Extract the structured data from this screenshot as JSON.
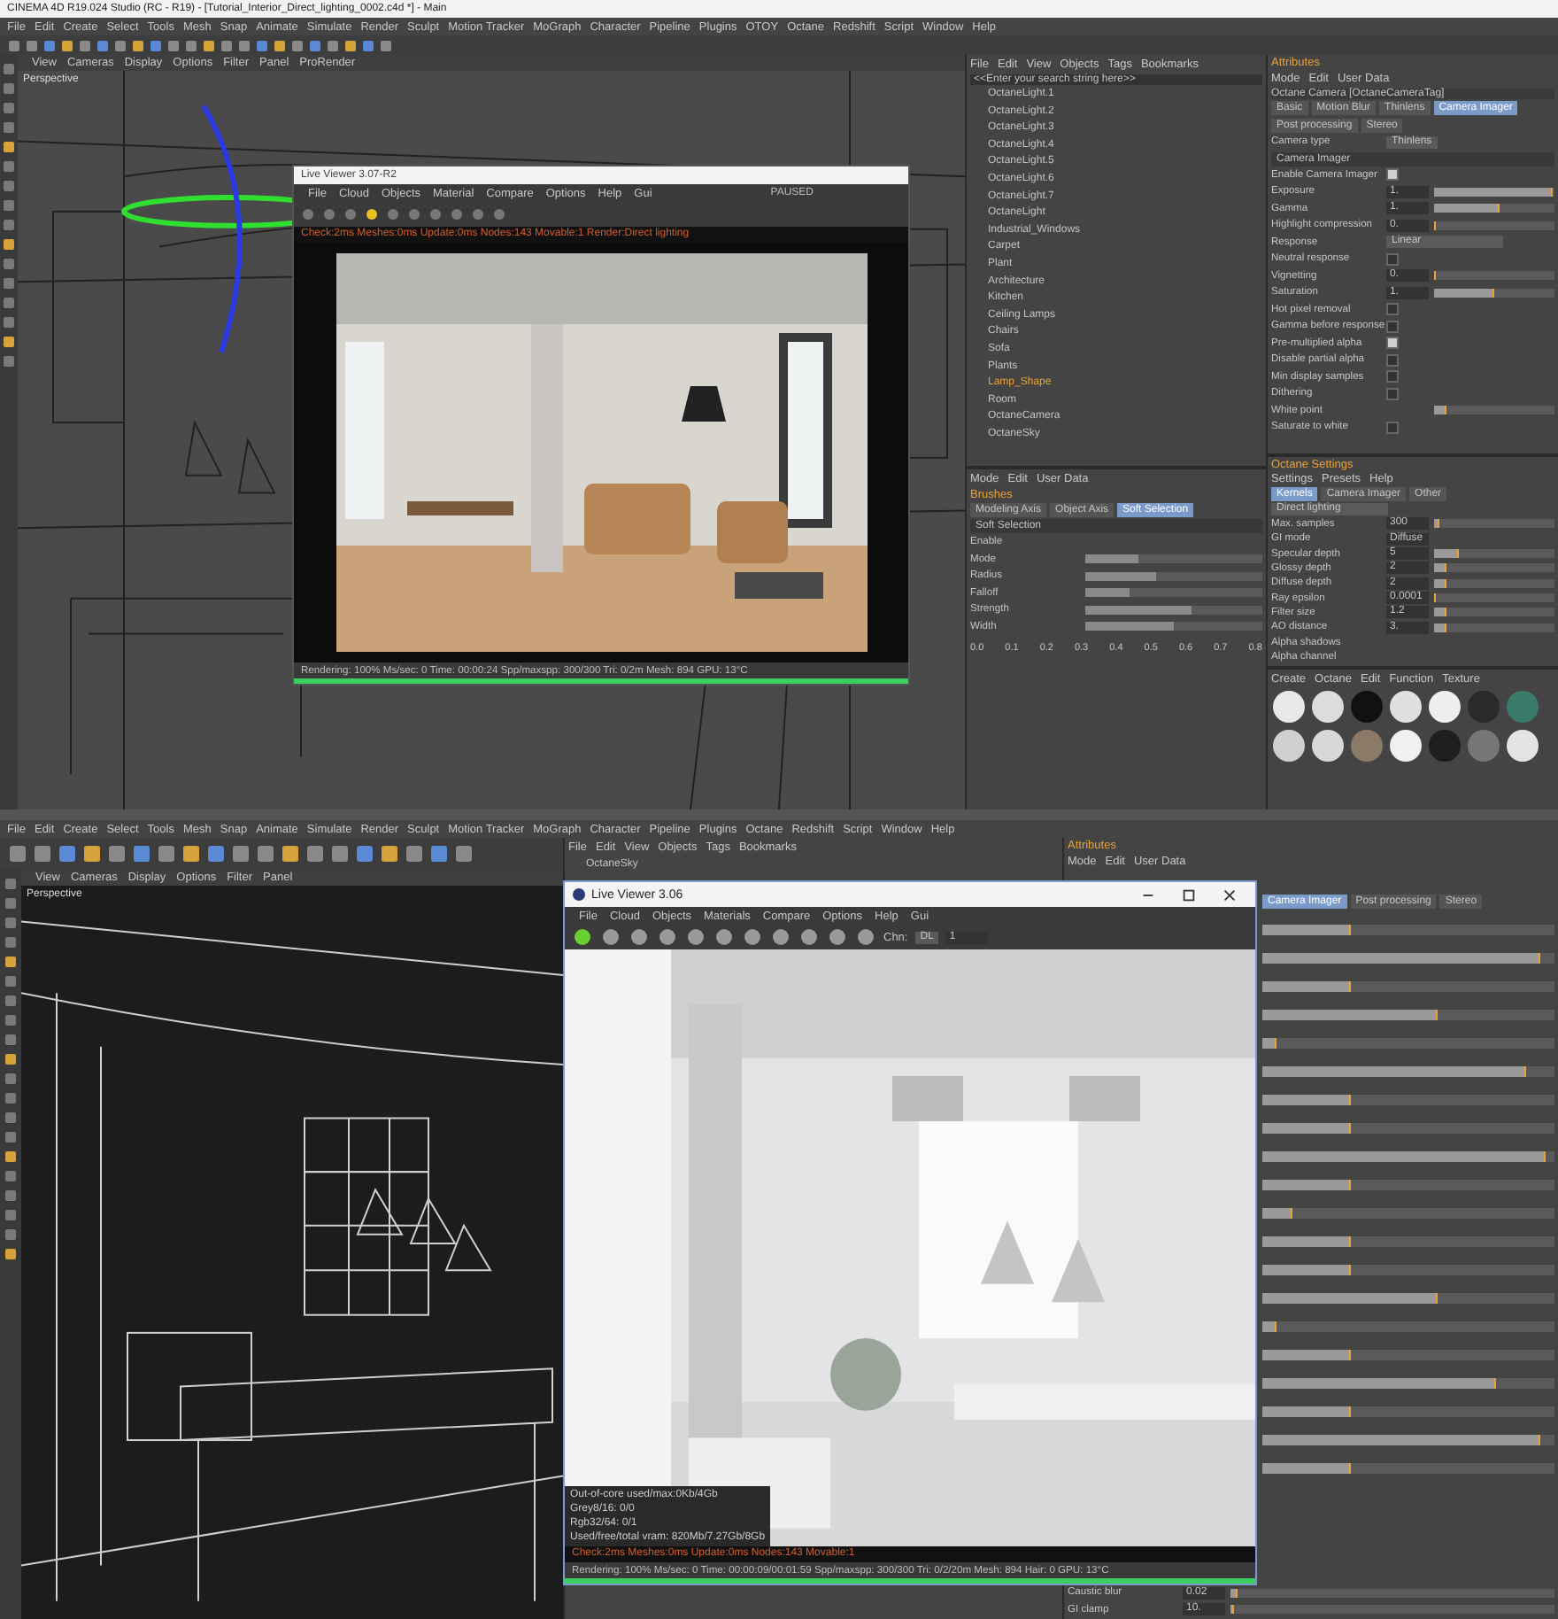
{
  "top": {
    "title": "CINEMA 4D R19.024 Studio (RC - R19) - [Tutorial_Interior_Direct_lighting_0002.c4d *] - Main",
    "menu": [
      "File",
      "Edit",
      "Create",
      "Select",
      "Tools",
      "Mesh",
      "Snap",
      "Animate",
      "Simulate",
      "Render",
      "Sculpt",
      "Motion Tracker",
      "MoGraph",
      "Character",
      "Pipeline",
      "Plugins",
      "OTOY",
      "Octane",
      "Redshift",
      "Script",
      "Window",
      "Help"
    ],
    "viewport": {
      "menu": [
        "View",
        "Cameras",
        "Display",
        "Options",
        "Filter",
        "Panel",
        "ProRender"
      ],
      "label": "Perspective"
    },
    "live_viewer": {
      "title": "Live Viewer 3.07-R2",
      "menu": [
        "File",
        "Cloud",
        "Objects",
        "Material",
        "Compare",
        "Options",
        "Help",
        "Gui"
      ],
      "state": "PAUSED",
      "status": "Check:2ms Meshes:0ms Update:0ms Nodes:143 Movable:1 Render:Direct lighting",
      "footer": "Rendering: 100%  Ms/sec: 0  Time: 00:00:24  Spp/maxspp: 300/300  Tri: 0/2m  Mesh: 894  GPU: 13°C",
      "level": 1
    },
    "objects": {
      "menu": [
        "File",
        "Edit",
        "View",
        "Objects",
        "Tags",
        "Bookmarks"
      ],
      "search": "<<Enter your search string here>>",
      "items": [
        {
          "name": "OctaneLight.1",
          "selected": false
        },
        {
          "name": "OctaneLight.2",
          "selected": false
        },
        {
          "name": "OctaneLight.3",
          "selected": false
        },
        {
          "name": "OctaneLight.4",
          "selected": false
        },
        {
          "name": "OctaneLight.5",
          "selected": false
        },
        {
          "name": "OctaneLight.6",
          "selected": false
        },
        {
          "name": "OctaneLight.7",
          "selected": false
        },
        {
          "name": "OctaneLight",
          "selected": false
        },
        {
          "name": "Industrial_Windows",
          "selected": false
        },
        {
          "name": "Carpet",
          "selected": false
        },
        {
          "name": "Plant",
          "selected": false
        },
        {
          "name": "Architecture",
          "selected": false
        },
        {
          "name": "Kitchen",
          "selected": false
        },
        {
          "name": "Ceiling Lamps",
          "selected": false
        },
        {
          "name": "Chairs",
          "selected": false
        },
        {
          "name": "Sofa",
          "selected": false
        },
        {
          "name": "Plants",
          "selected": false
        },
        {
          "name": "Lamp_Shape",
          "selected": true
        },
        {
          "name": "Room",
          "selected": false
        },
        {
          "name": "OctaneCamera",
          "selected": false
        },
        {
          "name": "OctaneSky",
          "selected": false
        }
      ]
    },
    "attributes": {
      "title": "Attributes",
      "menu": [
        "Mode",
        "Edit",
        "User Data"
      ],
      "object": "Octane Camera [OctaneCameraTag]",
      "tabs": [
        {
          "label": "Basic",
          "selected": false
        },
        {
          "label": "Motion Blur",
          "selected": false
        },
        {
          "label": "Thinlens",
          "selected": false
        },
        {
          "label": "Camera Imager",
          "selected": true
        },
        {
          "label": "Post processing",
          "selected": false
        },
        {
          "label": "Stereo",
          "selected": false
        }
      ],
      "camera_type_label": "Camera type",
      "camera_type": "Thinlens",
      "section": "Camera Imager",
      "params": [
        {
          "kind": "check",
          "label": "Enable Camera Imager",
          "checked": true
        },
        {
          "kind": "slider",
          "label": "Exposure",
          "value": "1.",
          "level": 0.98
        },
        {
          "kind": "slider",
          "label": "Gamma",
          "value": "1.",
          "level": 0.55
        },
        {
          "kind": "slider",
          "label": "Highlight compression",
          "value": "0.",
          "level": 0.02
        },
        {
          "kind": "select",
          "label": "Response",
          "value": "Linear"
        },
        {
          "kind": "check",
          "label": "Neutral response",
          "checked": false
        },
        {
          "kind": "slider",
          "label": "Vignetting",
          "value": "0.",
          "level": 0.02
        },
        {
          "kind": "slider",
          "label": "Saturation",
          "value": "1.",
          "level": 0.5
        },
        {
          "kind": "check",
          "label": "Hot pixel removal",
          "checked": false
        },
        {
          "kind": "check",
          "label": "Gamma before response",
          "checked": false
        },
        {
          "kind": "check",
          "label": "Pre-multiplied alpha",
          "checked": true
        },
        {
          "kind": "check",
          "label": "Disable partial alpha",
          "checked": false
        },
        {
          "kind": "check",
          "label": "Min display samples",
          "checked": false
        },
        {
          "kind": "check",
          "label": "Dithering",
          "checked": false
        },
        {
          "kind": "slider",
          "label": "White point",
          "level": 0.1
        },
        {
          "kind": "check",
          "label": "Saturate to white",
          "checked": false
        }
      ]
    },
    "modeling": {
      "menu": [
        "Mode",
        "Edit",
        "User Data"
      ],
      "title": "Brushes",
      "tabs": [
        {
          "label": "Modeling Axis",
          "selected": false
        },
        {
          "label": "Object Axis",
          "selected": false
        },
        {
          "label": "Soft Selection",
          "selected": true
        }
      ],
      "section": "Soft Selection",
      "rows": [
        {
          "label": "Enable"
        },
        {
          "label": "Mode",
          "level": 0.3
        },
        {
          "label": "Radius",
          "level": 0.4
        },
        {
          "label": "Falloff",
          "level": 0.25
        },
        {
          "label": "Strength",
          "level": 0.6
        },
        {
          "label": "Width",
          "level": 0.5
        }
      ],
      "axis": [
        "0.0",
        "0.1",
        "0.2",
        "0.3",
        "0.4",
        "0.5",
        "0.6",
        "0.7",
        "0.8"
      ]
    },
    "octane": {
      "title": "Octane Settings",
      "menu": [
        "Settings",
        "Presets",
        "Help"
      ],
      "tabs": [
        {
          "label": "Kernels",
          "selected": true
        },
        {
          "label": "Camera Imager",
          "selected": false
        },
        {
          "label": "Other",
          "selected": false
        }
      ],
      "kernel": "Direct lighting",
      "rows": [
        {
          "label": "Max. samples",
          "value": "300",
          "level": 0.05
        },
        {
          "label": "GI mode",
          "value": "Diffuse"
        },
        {
          "label": "Specular depth",
          "value": "5",
          "level": 0.2
        },
        {
          "label": "Glossy depth",
          "value": "2",
          "level": 0.1
        },
        {
          "label": "Diffuse depth",
          "value": "2",
          "level": 0.1
        },
        {
          "label": "Ray epsilon",
          "value": "0.0001",
          "level": 0.02
        },
        {
          "label": "Filter size",
          "value": "1.2",
          "level": 0.1
        },
        {
          "label": "AO distance",
          "value": "3.",
          "level": 0.1
        },
        {
          "label": "Alpha shadows"
        },
        {
          "label": "Alpha channel"
        }
      ]
    },
    "materials": {
      "menu": [
        "Create",
        "Octane",
        "Edit",
        "Function",
        "Texture"
      ],
      "balls": [
        {
          "color": "#e8e8e8"
        },
        {
          "color": "#dcdcdc"
        },
        {
          "color": "#111111"
        },
        {
          "color": "#e0e0e0"
        },
        {
          "color": "#eeeeee"
        },
        {
          "color": "#2a2a2a"
        },
        {
          "color": "#3a7a6a"
        },
        {
          "color": "#cfcfcf"
        },
        {
          "color": "#d8d8d8"
        },
        {
          "color": "#8c7a68"
        },
        {
          "color": "#f0f0f0"
        },
        {
          "color": "#1e1e1e"
        },
        {
          "color": "#767676"
        },
        {
          "color": "#e4e4e4"
        }
      ]
    }
  },
  "bottom": {
    "menu": [
      "File",
      "Edit",
      "Create",
      "Select",
      "Tools",
      "Mesh",
      "Snap",
      "Animate",
      "Simulate",
      "Render",
      "Sculpt",
      "Motion Tracker",
      "MoGraph",
      "Character",
      "Pipeline",
      "Plugins",
      "Octane",
      "Redshift",
      "Script",
      "Window",
      "Help"
    ],
    "viewport": {
      "menu": [
        "View",
        "Cameras",
        "Display",
        "Options",
        "Filter",
        "Panel"
      ],
      "label": "Perspective"
    },
    "objects": {
      "menu": [
        "File",
        "Edit",
        "View",
        "Objects",
        "Tags",
        "Bookmarks"
      ],
      "item": "OctaneSky"
    },
    "attributes": {
      "title": "Attributes",
      "menu": [
        "Mode",
        "Edit",
        "User Data"
      ],
      "tabs": [
        {
          "label": "Camera Imager",
          "selected": true
        },
        {
          "label": "Post processing",
          "selected": false
        },
        {
          "label": "Stereo",
          "selected": false
        }
      ],
      "sliders": [
        {
          "level": 0.3
        },
        {
          "level": 0.95
        },
        {
          "level": 0.3
        },
        {
          "level": 0.6
        },
        {
          "level": 0.05
        },
        {
          "level": 0.9
        },
        {
          "level": 0.3
        },
        {
          "level": 0.3
        },
        {
          "level": 0.97
        },
        {
          "level": 0.3
        },
        {
          "level": 0.1
        },
        {
          "level": 0.3
        },
        {
          "level": 0.3
        },
        {
          "level": 0.6
        },
        {
          "level": 0.05
        },
        {
          "level": 0.3
        },
        {
          "level": 0.8
        },
        {
          "level": 0.3
        },
        {
          "level": 0.95
        },
        {
          "level": 0.3
        }
      ],
      "params": [
        {
          "label": "Caustic blur",
          "value": "0.02",
          "level": 0.02
        },
        {
          "label": "GI clamp",
          "value": "10.",
          "level": 0.01
        }
      ]
    },
    "live_viewer": {
      "title": "Live Viewer 3.06",
      "menu": [
        "File",
        "Cloud",
        "Objects",
        "Materials",
        "Compare",
        "Options",
        "Help",
        "Gui"
      ],
      "channel_label": "Chn:",
      "channel": "DL",
      "layer": "1",
      "status": "Check:2ms Meshes:0ms Update:0ms Nodes:143 Movable:1",
      "stats": [
        "Out-of-core used/max:0Kb/4Gb",
        "Grey8/16: 0/0",
        "Rgb32/64: 0/1",
        "Used/free/total vram: 820Mb/7.27Gb/8Gb"
      ],
      "footer": "Rendering: 100%  Ms/sec: 0  Time: 00:00:09/00:01:59  Spp/maxspp: 300/300  Tri: 0/2/20m  Mesh: 894  Hair: 0  GPU:   13°C",
      "level": 1
    }
  }
}
